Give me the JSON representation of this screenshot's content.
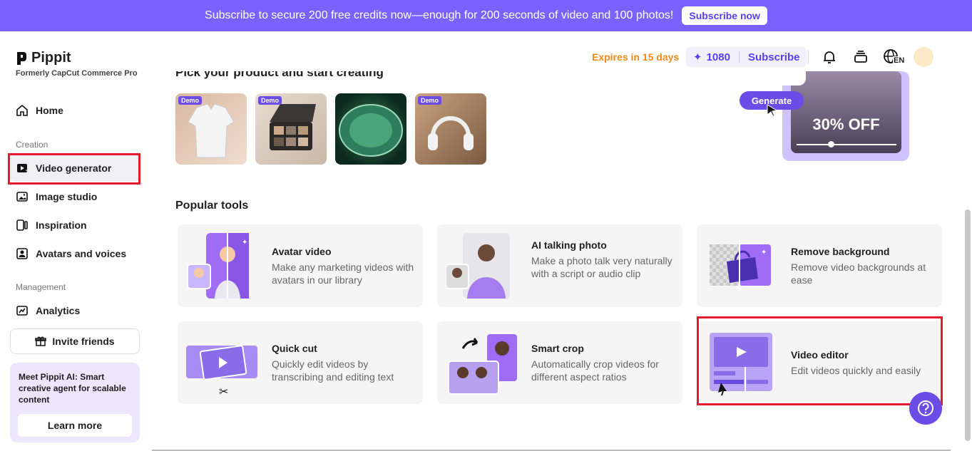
{
  "banner": {
    "text": "Subscribe to secure 200 free credits now—enough for 200 seconds of video and 100 photos!",
    "button": "Subscribe now"
  },
  "brand": {
    "name": "Pippit",
    "subtitle": "Formerly CapCut Commerce Pro"
  },
  "sidebar": {
    "home": "Home",
    "creation_label": "Creation",
    "items": [
      "Video generator",
      "Image studio",
      "Inspiration",
      "Avatars and voices"
    ],
    "management_label": "Management",
    "analytics": "Analytics",
    "invite": "Invite friends",
    "promo_text": "Meet Pippit AI: Smart creative agent for scalable content",
    "promo_button": "Learn more"
  },
  "topbar": {
    "expires": "Expires in 15 days",
    "credits": "1080",
    "subscribe": "Subscribe",
    "lang": "EN"
  },
  "main": {
    "clipped_heading": "Pick your product and start creating",
    "demo_badge": "Demo",
    "hero_generate": "Generate",
    "hero_discount": "30% OFF",
    "popular_title": "Popular tools",
    "tools": [
      {
        "title": "Avatar video",
        "desc": "Make any marketing videos with avatars in our library"
      },
      {
        "title": "AI talking photo",
        "desc": "Make a photo talk very naturally with a script or audio clip"
      },
      {
        "title": "Remove background",
        "desc": "Remove video backgrounds at ease"
      },
      {
        "title": "Quick cut",
        "desc": "Quickly edit videos by transcribing and editing text"
      },
      {
        "title": "Smart crop",
        "desc": "Automatically crop videos for different aspect ratios"
      },
      {
        "title": "Video editor",
        "desc": "Edit videos quickly and easily"
      }
    ]
  },
  "colors": {
    "accent": "#7b61ff",
    "highlight": "#e31b2a",
    "expires": "#f08a1a"
  }
}
